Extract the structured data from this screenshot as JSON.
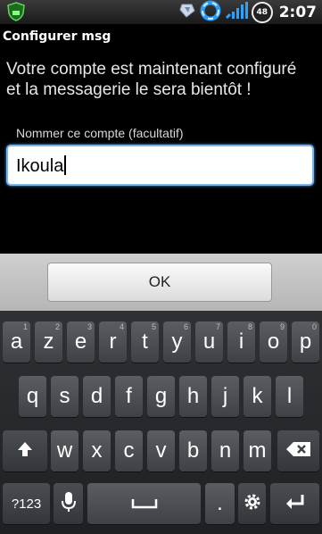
{
  "status": {
    "time": "2:07",
    "battery": "48"
  },
  "title": "Configurer msg",
  "message": "Votre compte est maintenant configuré et la messagerie le sera bientôt !",
  "field": {
    "label": "Nommer ce compte (facultatif)",
    "value": "Ikoula"
  },
  "keyboard": {
    "ok_label": "OK",
    "row1": [
      {
        "key": "a",
        "hint": "1"
      },
      {
        "key": "z",
        "hint": "2"
      },
      {
        "key": "e",
        "hint": "3"
      },
      {
        "key": "r",
        "hint": "4"
      },
      {
        "key": "t",
        "hint": "5"
      },
      {
        "key": "y",
        "hint": "6"
      },
      {
        "key": "u",
        "hint": "7"
      },
      {
        "key": "i",
        "hint": "8"
      },
      {
        "key": "o",
        "hint": "9"
      },
      {
        "key": "p",
        "hint": "0"
      }
    ],
    "row2": [
      "q",
      "s",
      "d",
      "f",
      "g",
      "h",
      "j",
      "k",
      "l"
    ],
    "row3": [
      "w",
      "x",
      "c",
      "v",
      "b",
      "n",
      "m"
    ],
    "sym_label": "?123",
    "period_label": "."
  }
}
